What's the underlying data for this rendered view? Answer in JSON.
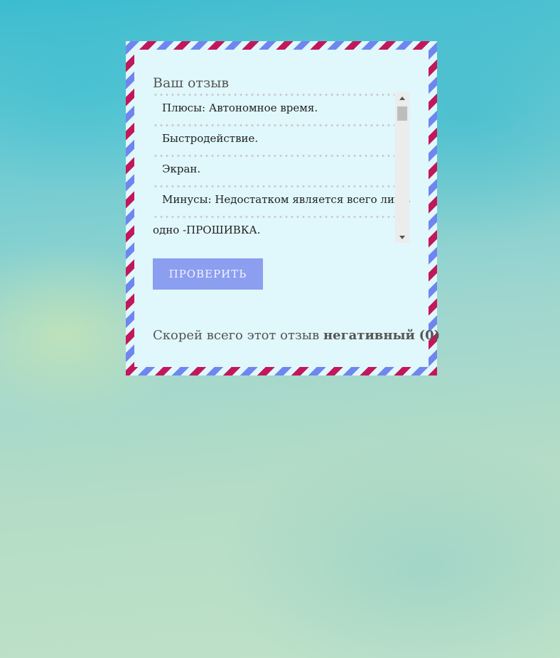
{
  "form": {
    "label": "Ваш отзыв",
    "review_lines": [
      "Плюсы:   Автономное время.",
      "Быстродействие.",
      "Экран.",
      "Минусы: Недостатком является всего лишь",
      "одно -ПРОШИВКА."
    ],
    "check_button": "ПРОВЕРИТЬ"
  },
  "result": {
    "prefix": "Скорей всего этот отзыв",
    "sentiment": "негативный",
    "score": "(0)"
  },
  "colors": {
    "border_red": "#c2185b",
    "border_blue": "#6f86f0",
    "card_bg": "#e0f7fb",
    "button_bg": "#8c9ef0"
  }
}
